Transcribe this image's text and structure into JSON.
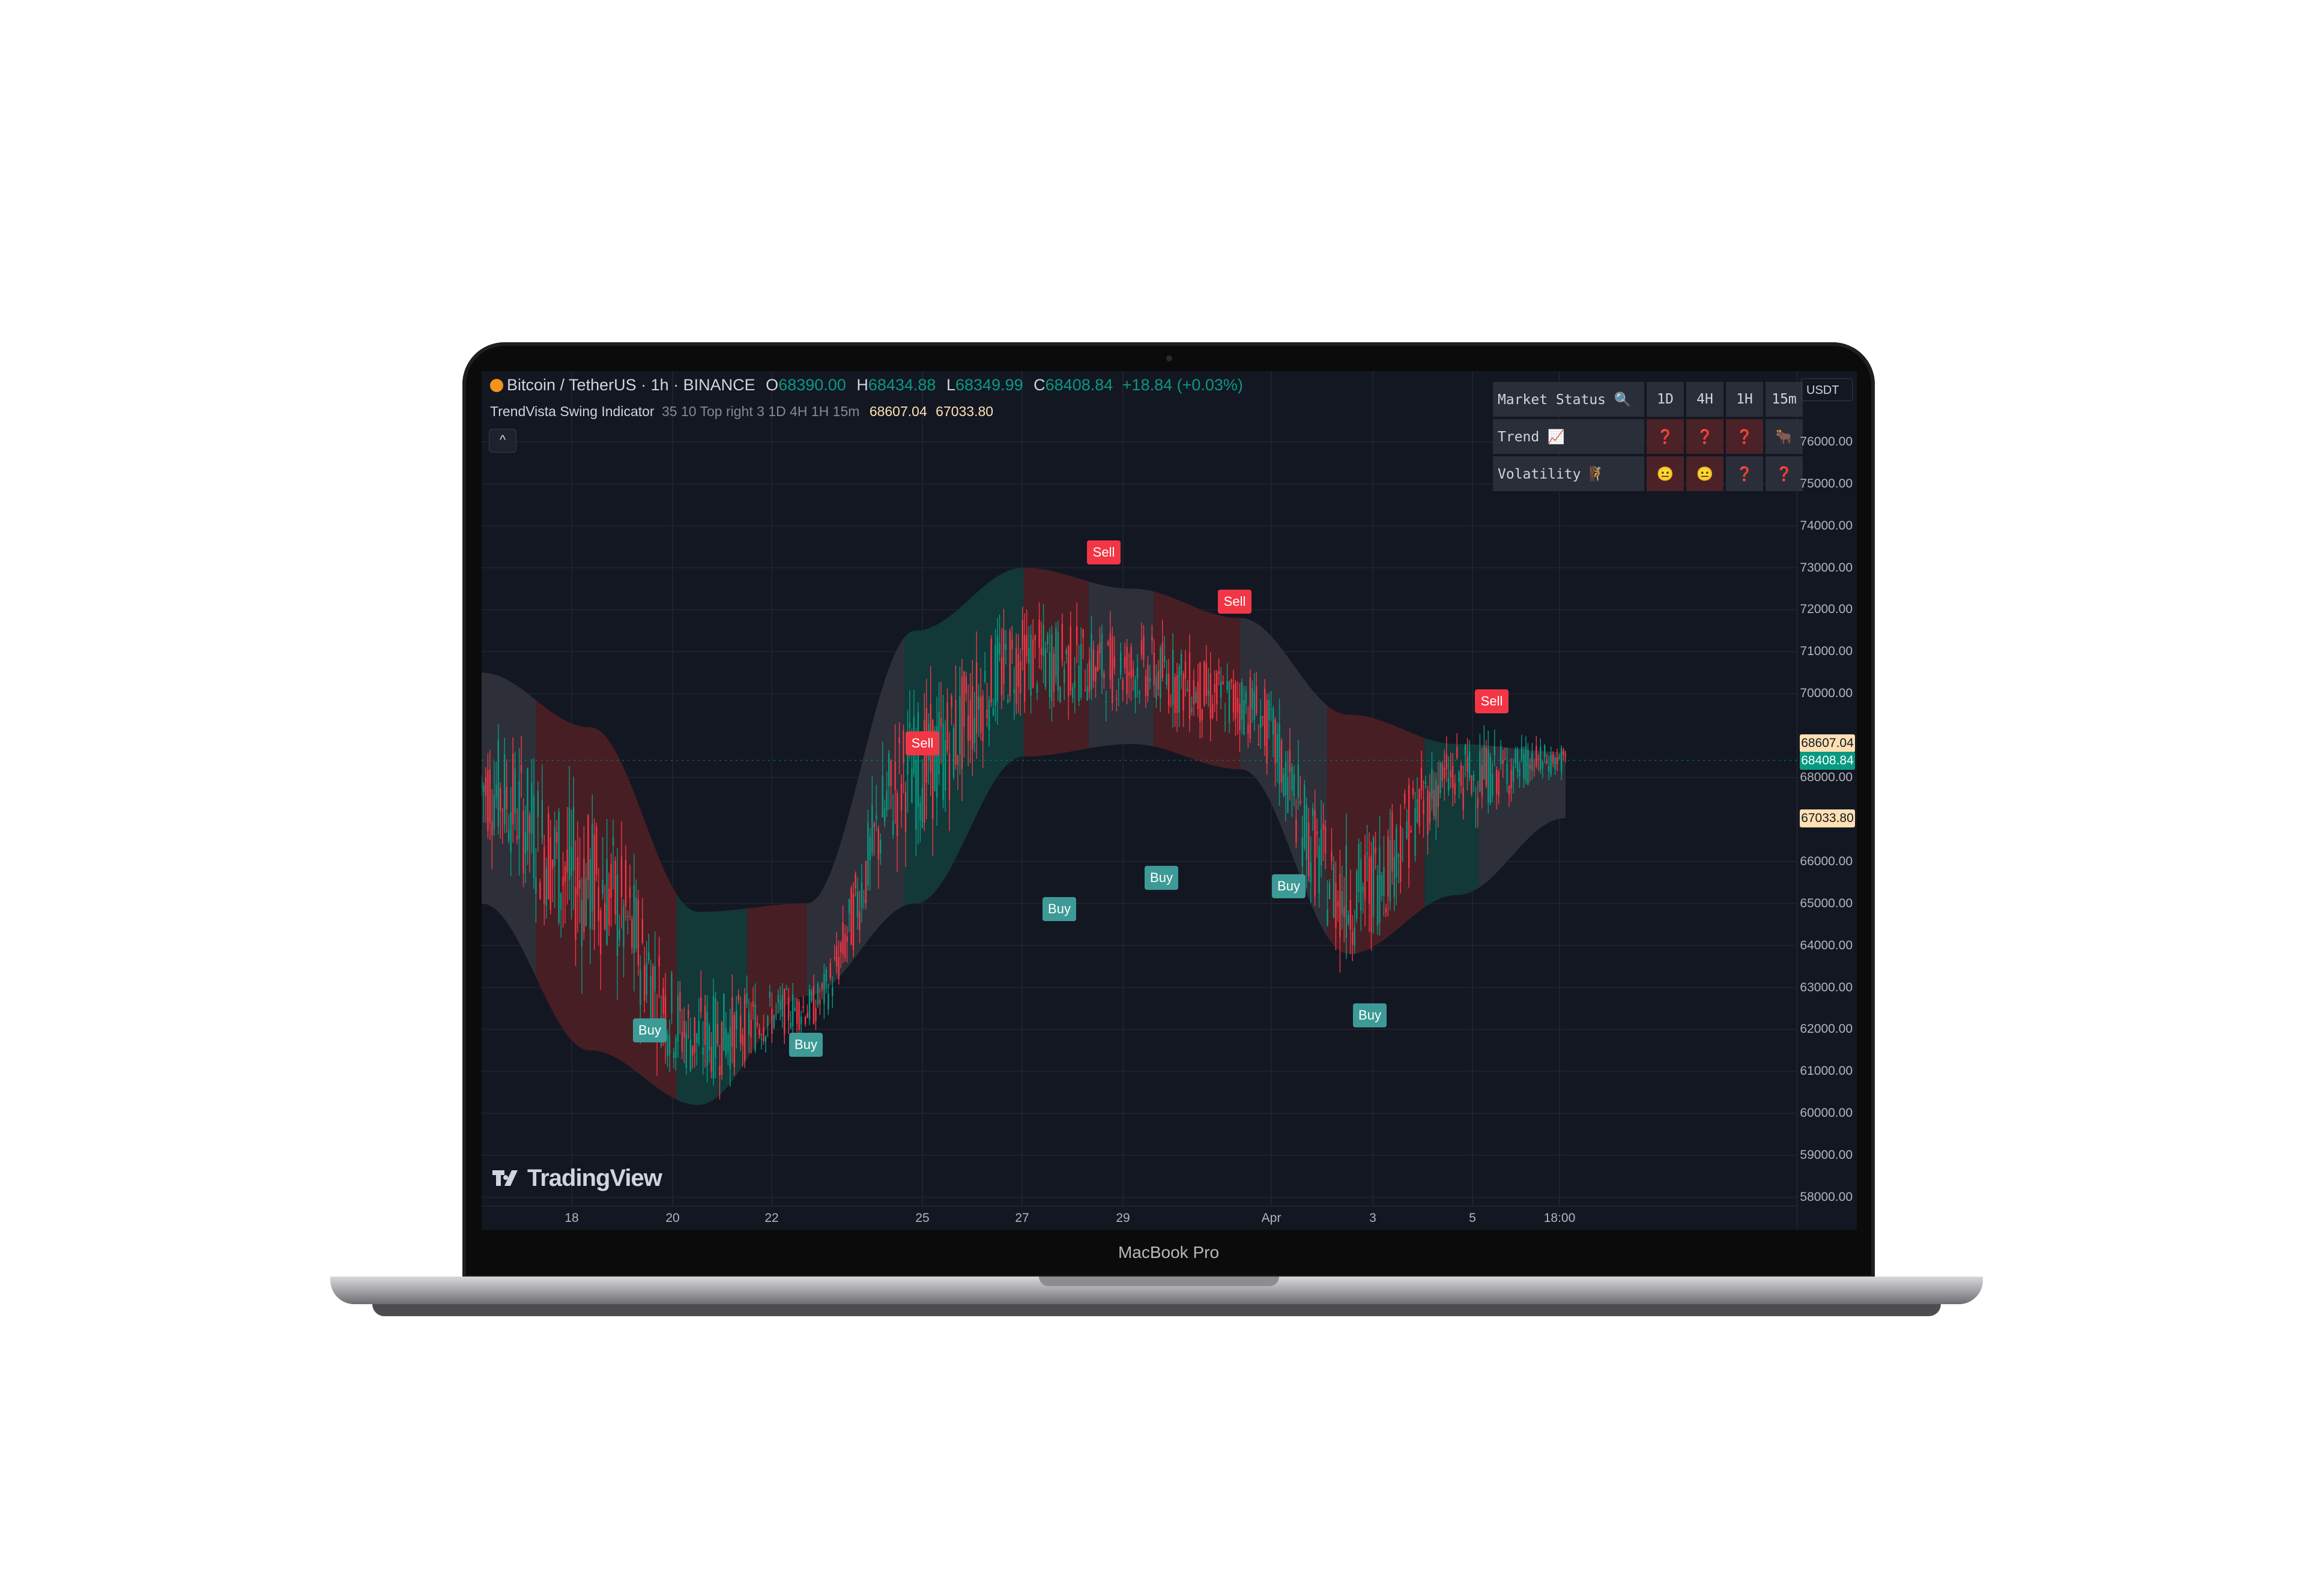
{
  "device_label": "MacBook Pro",
  "legend": {
    "symbol": "Bitcoin / TetherUS · 1h · BINANCE",
    "o_key": "O",
    "o_val": "68390.00",
    "h_key": "H",
    "h_val": "68434.88",
    "l_key": "L",
    "l_val": "68349.99",
    "c_key": "C",
    "c_val": "68408.84",
    "change": "+18.84 (+0.03%)"
  },
  "indicator": {
    "name": "TrendVista Swing Indicator",
    "params": "35 10 Top right 3 1D 4H 1H 15m",
    "value1": "68607.04",
    "value2": "67033.80",
    "collapse_icon": "chevron-up-icon",
    "collapse_glyph": "^"
  },
  "status_table": {
    "title": "Market Status 🔍",
    "timeframes": [
      "1D",
      "4H",
      "1H",
      "15m"
    ],
    "rows": [
      {
        "label": "Trend 📈",
        "cells": [
          "❓",
          "❓",
          "❓",
          "🐂"
        ]
      },
      {
        "label": "Volatility 🧗",
        "cells": [
          "😐",
          "😐",
          "❓",
          "❓"
        ]
      }
    ]
  },
  "price_axis": {
    "currency": "USDT",
    "labels": [
      "76000.00",
      "75000.00",
      "74000.00",
      "73000.00",
      "72000.00",
      "71000.00",
      "70000.00",
      "68000.00",
      "66000.00",
      "65000.00",
      "64000.00",
      "63000.00",
      "62000.00",
      "61000.00",
      "60000.00",
      "59000.00",
      "58000.00"
    ],
    "tag_upper": "68607.04",
    "tag_last": "68408.84",
    "tag_lower": "67033.80"
  },
  "time_axis": {
    "labels": [
      "18",
      "20",
      "22",
      "25",
      "27",
      "29",
      "Apr",
      "3",
      "5",
      "18:00"
    ]
  },
  "watermark": "TradingView",
  "signals": [
    {
      "type": "Buy",
      "label": "Buy"
    },
    {
      "type": "Buy",
      "label": "Buy"
    },
    {
      "type": "Sell",
      "label": "Sell"
    },
    {
      "type": "Buy",
      "label": "Buy"
    },
    {
      "type": "Sell",
      "label": "Sell"
    },
    {
      "type": "Buy",
      "label": "Buy"
    },
    {
      "type": "Sell",
      "label": "Sell"
    },
    {
      "type": "Buy",
      "label": "Buy"
    },
    {
      "type": "Buy",
      "label": "Buy"
    },
    {
      "type": "Sell",
      "label": "Sell"
    }
  ],
  "colors": {
    "background": "#131722",
    "bull": "#089981",
    "bear": "#f23645",
    "band_bull": "#123a3a",
    "band_bear": "#4a1f25",
    "band_neutral": "#2e313b",
    "buy_label": "#3d9a96",
    "sell_label": "#f23645"
  },
  "chart_data": {
    "type": "line",
    "symbol": "Bitcoin / TetherUS",
    "timeframe": "1h",
    "x": [
      "18",
      "20",
      "22",
      "25",
      "27",
      "29",
      "Apr",
      "3",
      "5",
      "18:00"
    ],
    "series": [
      {
        "values": [
          67800,
          65500,
          61800,
          62500,
          68200,
          70800,
          70600,
          69800,
          65200,
          68000,
          68409
        ]
      },
      {
        "values": [
          70500,
          69200,
          64800,
          65000,
          71500,
          73000,
          72500,
          71800,
          69500,
          68800,
          68607
        ]
      },
      {
        "values": [
          65000,
          61500,
          60200,
          62800,
          65000,
          68500,
          68800,
          68200,
          63800,
          65200,
          67034
        ]
      }
    ],
    "ylim": [
      58000,
      76000
    ]
  }
}
